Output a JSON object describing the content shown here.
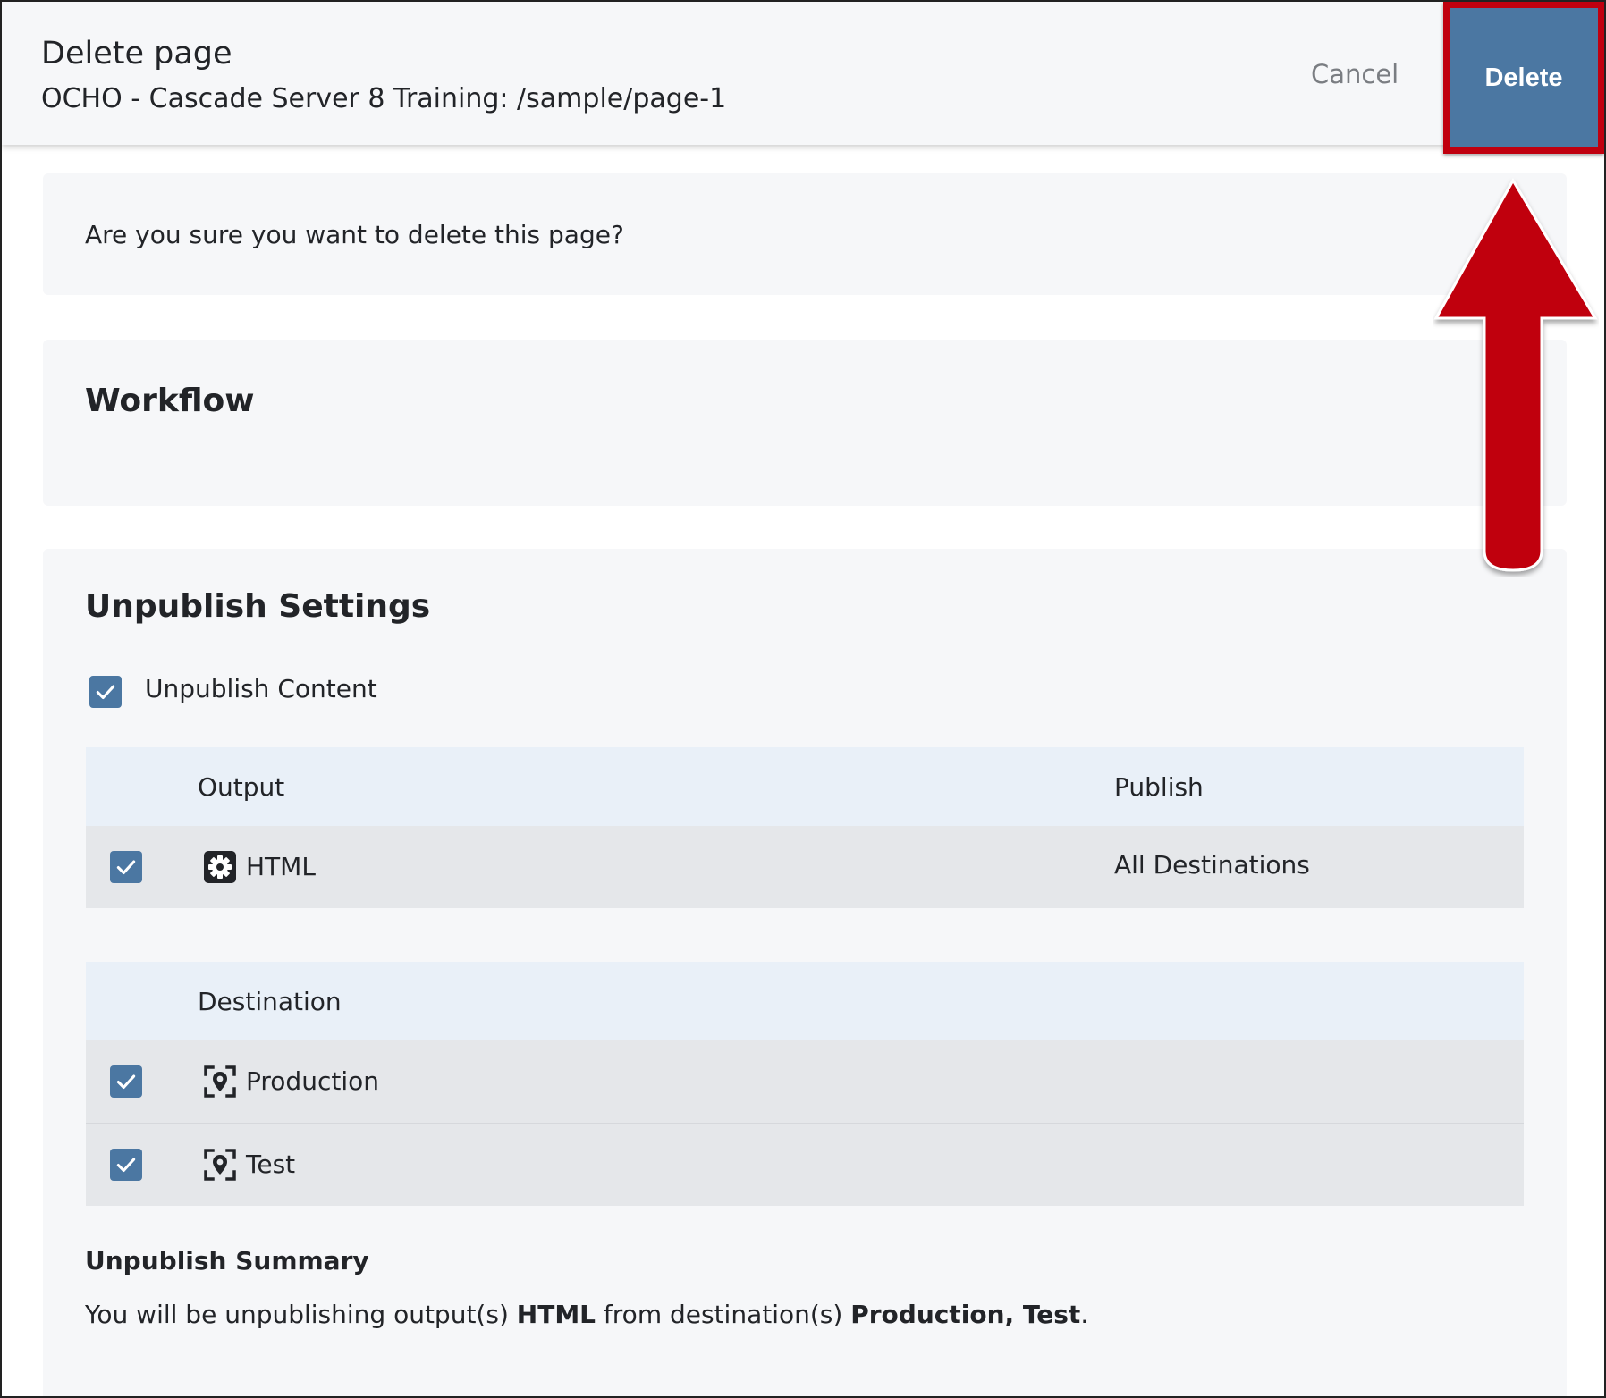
{
  "header": {
    "title": "Delete page",
    "subtitle": "OCHO - Cascade Server 8 Training: /sample/page-1",
    "cancel_label": "Cancel",
    "delete_label": "Delete"
  },
  "confirm": {
    "message": "Are you sure you want to delete this page?"
  },
  "workflow": {
    "heading": "Workflow"
  },
  "unpublish": {
    "heading": "Unpublish Settings",
    "content_checkbox_label": "Unpublish Content",
    "content_checked": true,
    "outputs_table": {
      "headers": [
        "Output",
        "Publish"
      ],
      "rows": [
        {
          "label": "HTML",
          "publish": "All Destinations",
          "checked": true,
          "icon": "gear-icon"
        }
      ]
    },
    "destinations_table": {
      "headers": [
        "Destination"
      ],
      "rows": [
        {
          "label": "Production",
          "checked": true,
          "icon": "location-target-icon"
        },
        {
          "label": "Test",
          "checked": true,
          "icon": "location-target-icon"
        }
      ]
    },
    "summary": {
      "heading": "Unpublish Summary",
      "prefix": "You will be unpublishing output(s) ",
      "outputs": "HTML",
      "middle": " from destination(s) ",
      "destinations": "Production, Test",
      "suffix": "."
    }
  },
  "colors": {
    "accent": "#4b77a2",
    "annotation_red": "#c0000f",
    "panel_bg": "#f6f7f9",
    "table_header_bg": "#e9f0f8",
    "table_row_bg": "#e5e7ea"
  }
}
